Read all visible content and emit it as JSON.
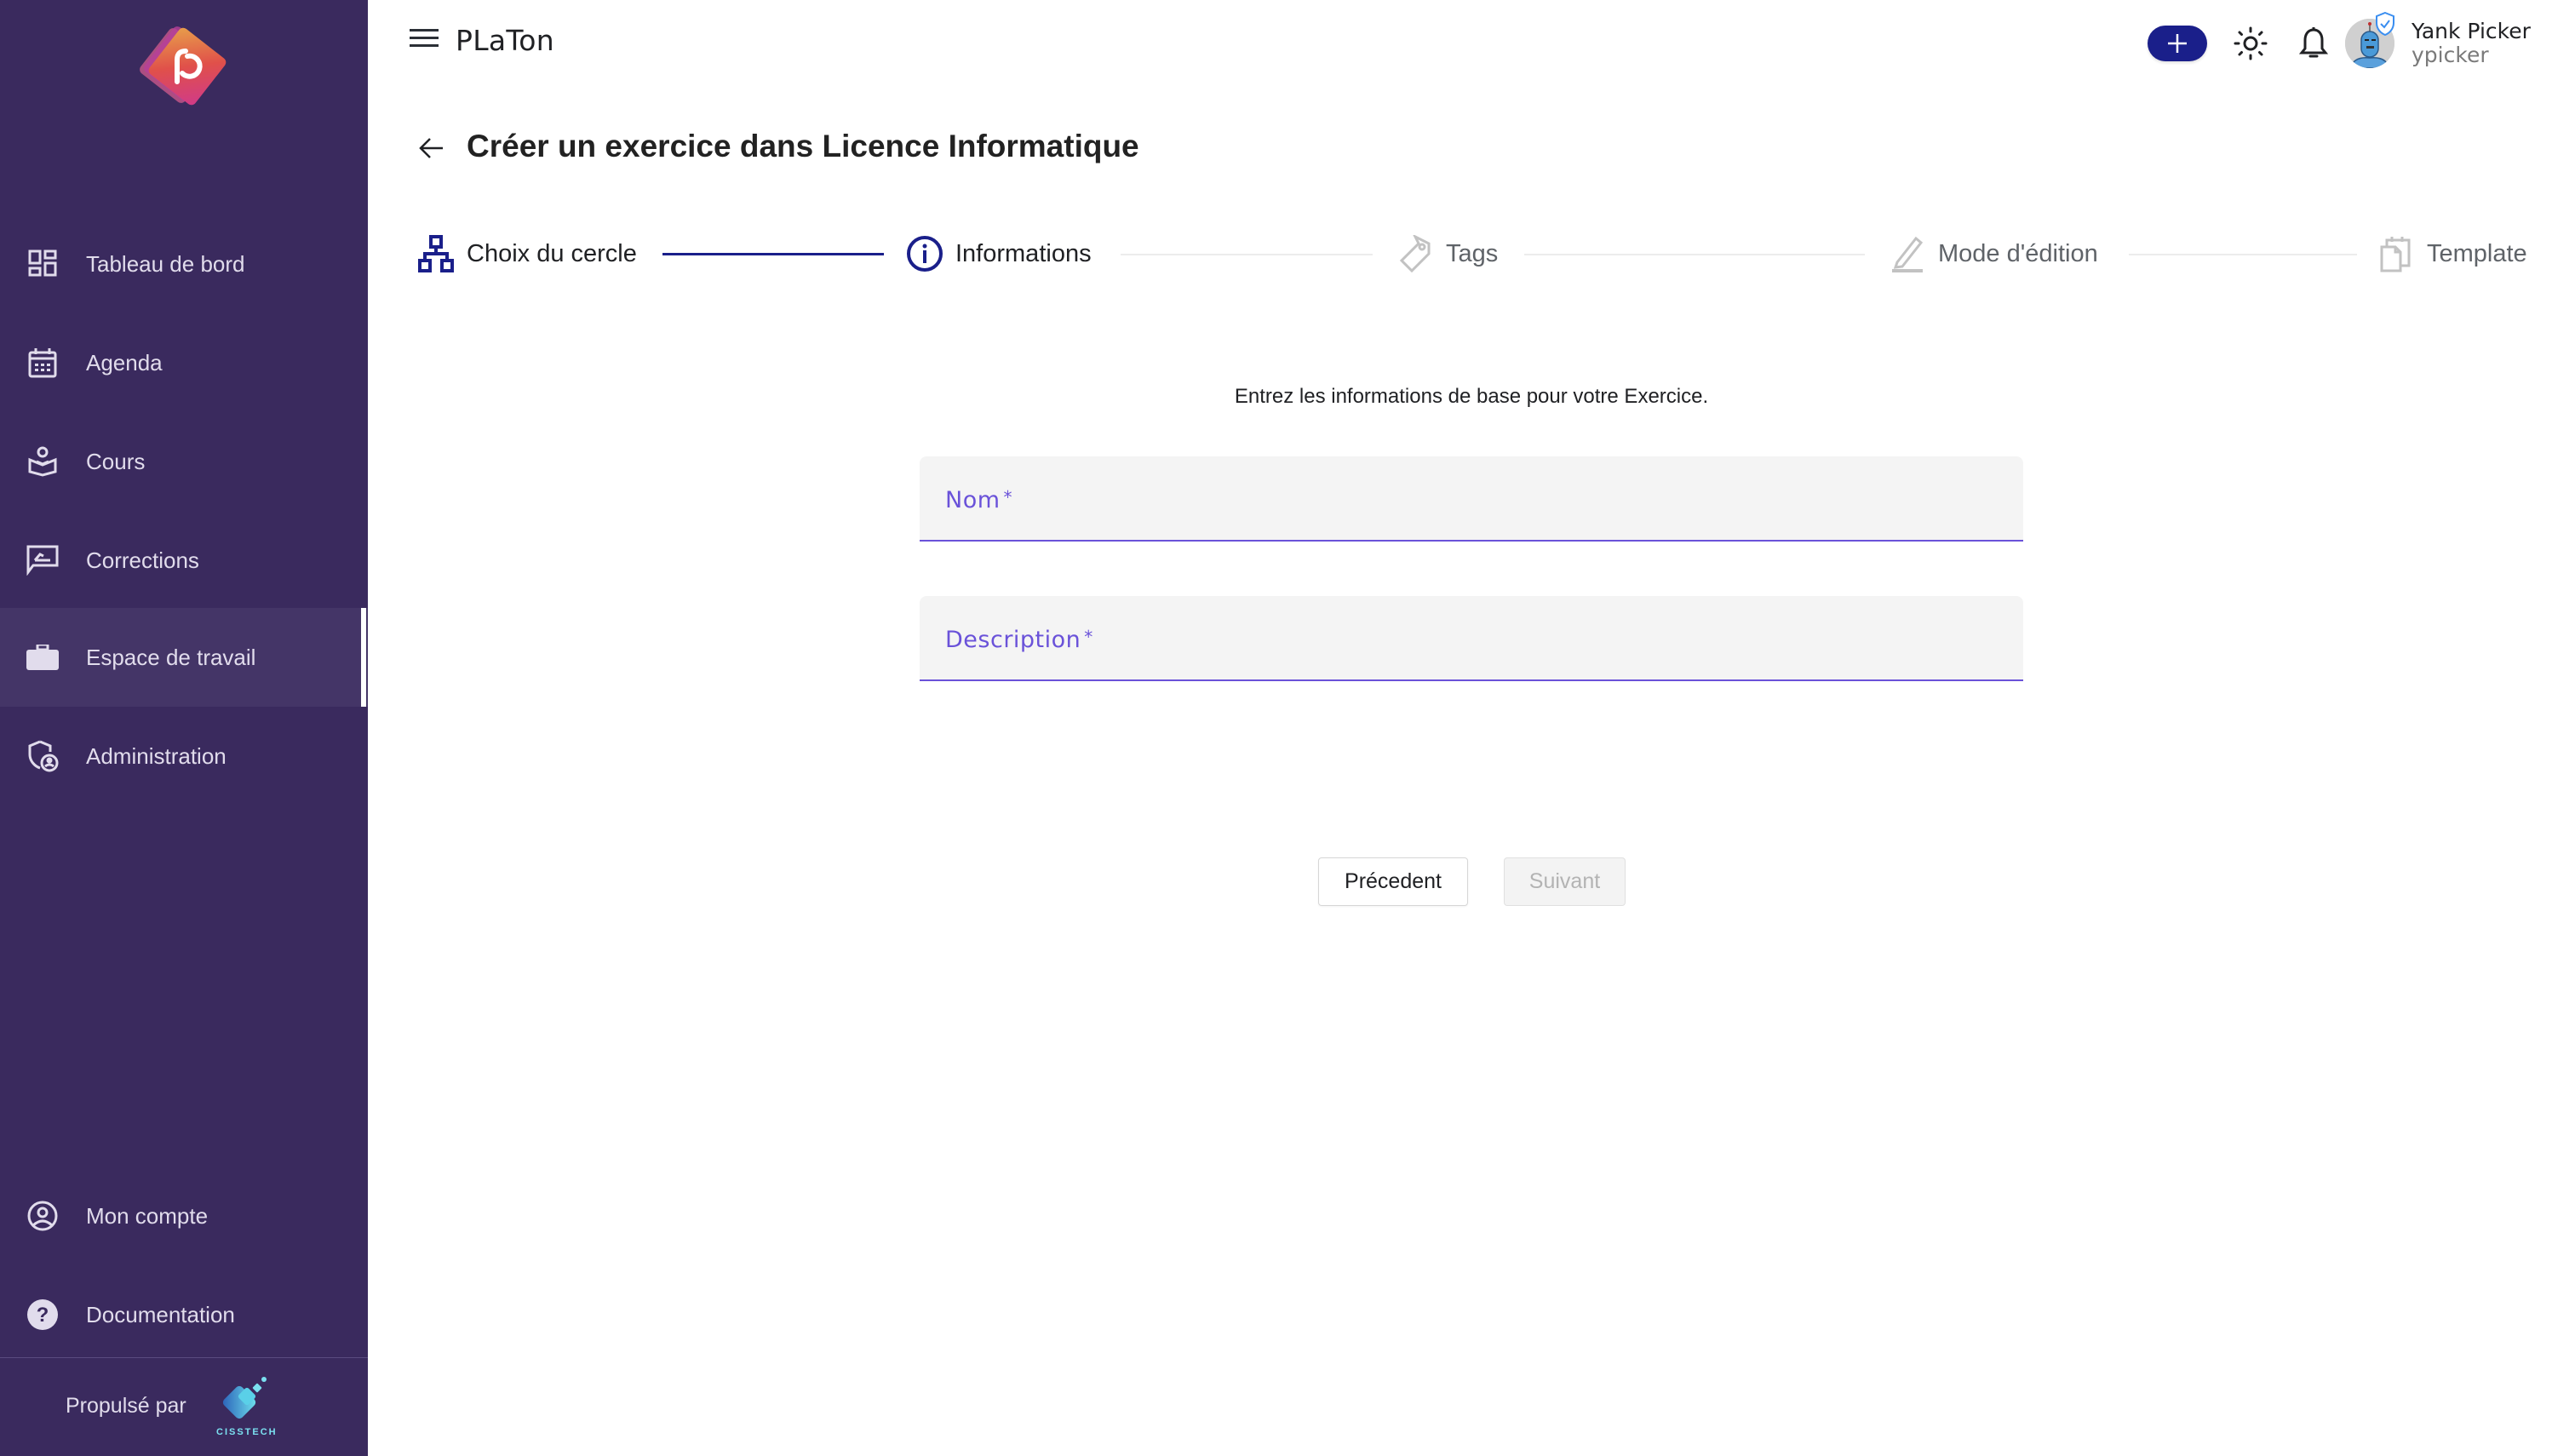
{
  "app": {
    "title": "PLaTon"
  },
  "sidebar": {
    "items": [
      {
        "label": "Tableau de bord",
        "icon": "dashboard-icon"
      },
      {
        "label": "Agenda",
        "icon": "calendar-icon"
      },
      {
        "label": "Cours",
        "icon": "course-icon"
      },
      {
        "label": "Corrections",
        "icon": "corrections-icon"
      },
      {
        "label": "Espace de travail",
        "icon": "briefcase-icon",
        "active": true
      },
      {
        "label": "Administration",
        "icon": "admin-shield-icon"
      }
    ],
    "bottom_items": [
      {
        "label": "Mon compte",
        "icon": "account-icon"
      },
      {
        "label": "Documentation",
        "icon": "help-icon"
      }
    ],
    "powered_by": "Propulsé par",
    "powered_brand": "CISSTECH"
  },
  "header": {
    "user_name": "Yank Picker",
    "user_login": "ypicker"
  },
  "page": {
    "title": "Créer un exercice dans Licence Informatique",
    "steps": [
      {
        "label": "Choix du cercle",
        "state": "done"
      },
      {
        "label": "Informations",
        "state": "current"
      },
      {
        "label": "Tags",
        "state": "todo"
      },
      {
        "label": "Mode d'édition",
        "state": "todo"
      },
      {
        "label": "Template",
        "state": "todo"
      }
    ],
    "intro": "Entrez les informations de base pour votre Exercice.",
    "fields": {
      "name": {
        "label": "Nom",
        "required_mark": "*",
        "value": ""
      },
      "description": {
        "label": "Description",
        "required_mark": "*",
        "value": ""
      }
    },
    "buttons": {
      "previous": "Précedent",
      "next": "Suivant"
    }
  },
  "colors": {
    "sidebar_bg": "#3a2a5e",
    "accent": "#1a1f8a",
    "field_accent": "#6a52d9"
  }
}
